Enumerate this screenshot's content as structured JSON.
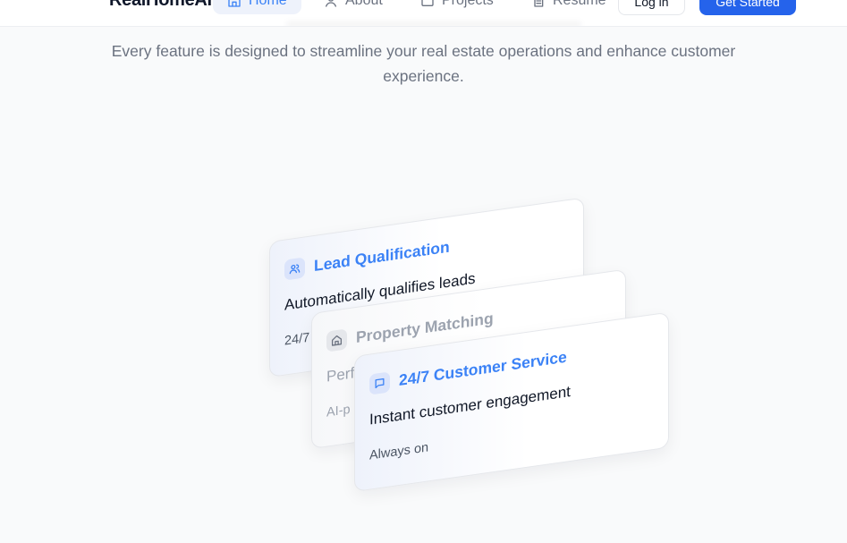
{
  "header": {
    "brand": "RealHomeAI",
    "nav": [
      {
        "label": "Home",
        "icon": "home-icon",
        "active": true
      },
      {
        "label": "About",
        "icon": "user-icon",
        "active": false
      },
      {
        "label": "Projects",
        "icon": "briefcase-icon",
        "active": false
      },
      {
        "label": "Resume",
        "icon": "document-icon",
        "active": false
      }
    ],
    "login_label": "Log in",
    "cta_label": "Get Started"
  },
  "subtitle": "Every feature is designed to streamline your real estate operations and enhance customer experience.",
  "cards": [
    {
      "title": "Lead Qualification",
      "description": "Automatically qualifies leads",
      "footer": "24/7",
      "icon": "users-icon"
    },
    {
      "title": "Property Matching",
      "description": "Perf",
      "footer": "AI-p",
      "icon": "home-icon"
    },
    {
      "title": "24/7 Customer Service",
      "description": "Instant customer engagement",
      "footer": "Always on",
      "icon": "chat-icon"
    }
  ],
  "colors": {
    "accent": "#2563eb",
    "accent_text": "#3b82f6",
    "page_bg": "#f9fafb"
  }
}
